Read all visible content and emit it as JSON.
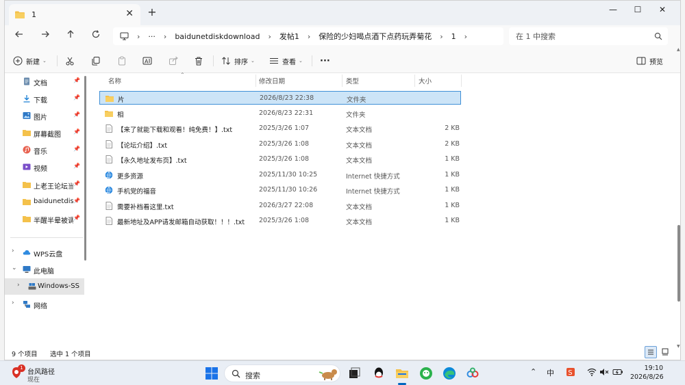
{
  "window": {
    "tab_title": "1",
    "tab_close": "✕",
    "new_tab": "+",
    "minimize": "—",
    "maximize": "☐",
    "close": "✕"
  },
  "address": {
    "more": "···",
    "segments": [
      "baidunetdiskdownload",
      "发帖1",
      "保险的少妇喝点酒下点药玩弄菊花",
      "1"
    ]
  },
  "search": {
    "placeholder": "在 1 中搜索"
  },
  "toolbar": {
    "new_label": "新建",
    "sort_label": "排序",
    "view_label": "查看",
    "more": "···",
    "preview_label": "预览"
  },
  "nav": {
    "quick": [
      {
        "label": "文档",
        "icon": "document-icon"
      },
      {
        "label": "下载",
        "icon": "download-icon"
      },
      {
        "label": "图片",
        "icon": "pictures-icon"
      },
      {
        "label": "屏幕截图",
        "icon": "folder-icon"
      },
      {
        "label": "音乐",
        "icon": "music-icon"
      },
      {
        "label": "视频",
        "icon": "video-icon"
      },
      {
        "label": "上老王论坛当",
        "icon": "folder-icon"
      },
      {
        "label": "baidunetdisk",
        "icon": "folder-icon"
      },
      {
        "label": "半醒半晕被调",
        "icon": "folder-icon"
      }
    ],
    "pin": "📌",
    "tree": [
      {
        "label": "WPS云盘",
        "chev": "›"
      },
      {
        "label": "此电脑",
        "chev": "⌄"
      },
      {
        "label": "Windows-SSD",
        "chev": "›"
      },
      {
        "label": "网络",
        "chev": "›"
      }
    ]
  },
  "columns": {
    "name": "名称",
    "date": "修改日期",
    "type": "类型",
    "size": "大小"
  },
  "files": [
    {
      "name": "片",
      "date": "2026/8/23 22:38",
      "type": "文件夹",
      "size": "",
      "icon": "folder-icon",
      "selected": true
    },
    {
      "name": "相",
      "date": "2026/8/23 22:31",
      "type": "文件夹",
      "size": "",
      "icon": "folder-icon"
    },
    {
      "name": "【来了就能下载和观看！纯免费！】.txt",
      "date": "2025/3/26 1:07",
      "type": "文本文档",
      "size": "2 KB",
      "icon": "text-file-icon"
    },
    {
      "name": "【论坛介绍】.txt",
      "date": "2025/3/26 1:08",
      "type": "文本文档",
      "size": "2 KB",
      "icon": "text-file-icon"
    },
    {
      "name": "【永久地址发布页】.txt",
      "date": "2025/3/26 1:08",
      "type": "文本文档",
      "size": "1 KB",
      "icon": "text-file-icon"
    },
    {
      "name": "更多资源",
      "date": "2025/11/30 10:25",
      "type": "Internet 快捷方式",
      "size": "1 KB",
      "icon": "internet-shortcut-icon"
    },
    {
      "name": "手机党的福音",
      "date": "2025/11/30 10:26",
      "type": "Internet 快捷方式",
      "size": "1 KB",
      "icon": "internet-shortcut-icon"
    },
    {
      "name": "需要补档看这里.txt",
      "date": "2026/3/27 22:08",
      "type": "文本文档",
      "size": "1 KB",
      "icon": "text-file-icon"
    },
    {
      "name": "最新地址及APP请发邮箱自动获取！！！.txt",
      "date": "2025/3/26 1:08",
      "type": "文本文档",
      "size": "1 KB",
      "icon": "text-file-icon"
    }
  ],
  "status": {
    "count": "9 个项目",
    "selected": "选中 1 个项目"
  },
  "taskbar": {
    "weather_title": "台风路径",
    "weather_sub": "现在",
    "weather_badge": "1",
    "search_label": "搜索",
    "tray_ime": "中",
    "time": "19:10",
    "date": "2026/8/26"
  },
  "colors": {
    "accent": "#0067c0",
    "selection": "#cce4f7",
    "folder": "#f4c14b"
  }
}
